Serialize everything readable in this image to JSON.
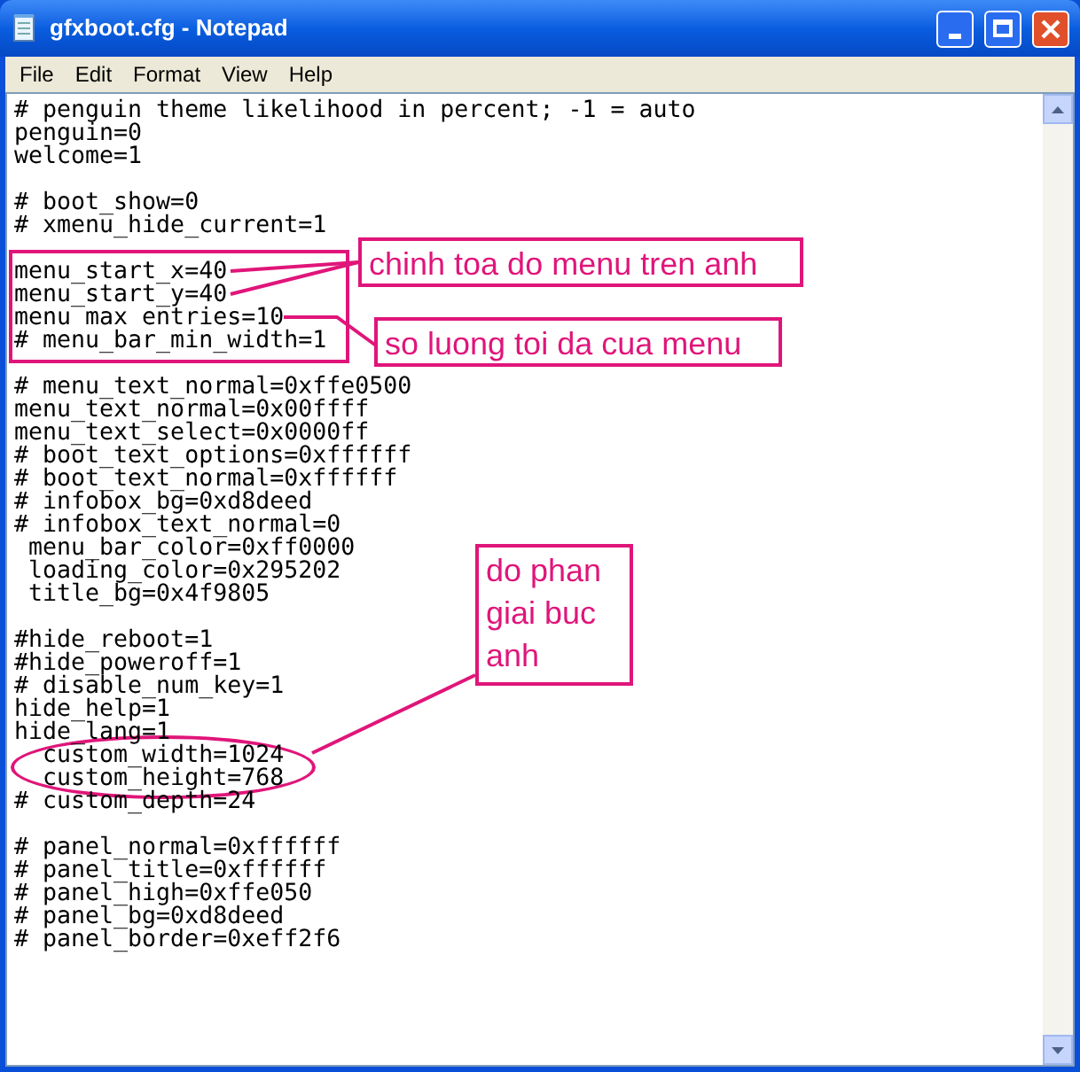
{
  "window": {
    "title": "gfxboot.cfg - Notepad"
  },
  "menu": [
    "File",
    "Edit",
    "Format",
    "View",
    "Help"
  ],
  "editor": {
    "lines": [
      {
        "kind": "code",
        "text": "# penguin theme likelihood in percent; -1 = auto"
      },
      {
        "kind": "code",
        "text": "penguin=0"
      },
      {
        "kind": "code",
        "text": "welcome=1"
      },
      {
        "kind": "blank"
      },
      {
        "kind": "code",
        "text": "# boot_show=0"
      },
      {
        "kind": "code",
        "text": "# xmenu_hide_current=1"
      },
      {
        "kind": "blank"
      },
      {
        "kind": "code",
        "text": "menu_start_x=40"
      },
      {
        "kind": "code",
        "text": "menu_start_y=40"
      },
      {
        "kind": "code",
        "text": "menu max entries=10"
      },
      {
        "kind": "code",
        "text": "# menu_bar_min_width=1"
      },
      {
        "kind": "blank"
      },
      {
        "kind": "code",
        "text": "# menu_text_normal=0xffe0500"
      },
      {
        "kind": "code",
        "text": "menu_text_normal=0x00ffff"
      },
      {
        "kind": "code",
        "text": "menu_text_select=0x0000ff"
      },
      {
        "kind": "code",
        "text": "# boot_text_options=0xffffff"
      },
      {
        "kind": "code",
        "text": "# boot_text_normal=0xffffff"
      },
      {
        "kind": "code",
        "text": "# infobox_bg=0xd8deed"
      },
      {
        "kind": "code",
        "text": "# infobox_text_normal=0"
      },
      {
        "kind": "code",
        "text": " menu_bar_color=0xff0000"
      },
      {
        "kind": "code",
        "text": " loading_color=0x295202"
      },
      {
        "kind": "code",
        "text": " title_bg=0x4f9805"
      },
      {
        "kind": "blank"
      },
      {
        "kind": "code",
        "text": "#hide_reboot=1"
      },
      {
        "kind": "code",
        "text": "#hide_poweroff=1"
      },
      {
        "kind": "code",
        "text": "# disable_num_key=1"
      },
      {
        "kind": "code",
        "text": "hide_help=1"
      },
      {
        "kind": "code",
        "text": "hide_lang=1"
      },
      {
        "kind": "code",
        "text": "  custom_width=1024"
      },
      {
        "kind": "code",
        "text": "  custom_height=768"
      },
      {
        "kind": "code",
        "text": "# custom_depth=24"
      },
      {
        "kind": "blank"
      },
      {
        "kind": "code",
        "text": "# panel_normal=0xffffff"
      },
      {
        "kind": "code",
        "text": "# panel_title=0xffffff"
      },
      {
        "kind": "code",
        "text": "# panel_high=0xffe050"
      },
      {
        "kind": "code",
        "text": "# panel_bg=0xd8deed"
      },
      {
        "kind": "code",
        "text": "# panel_border=0xeff2f6"
      }
    ]
  },
  "annotations": [
    {
      "text": "chinh toa do menu tren anh"
    },
    {
      "text": "so luong toi da cua menu"
    },
    {
      "text": "do phan giai buc anh"
    }
  ]
}
